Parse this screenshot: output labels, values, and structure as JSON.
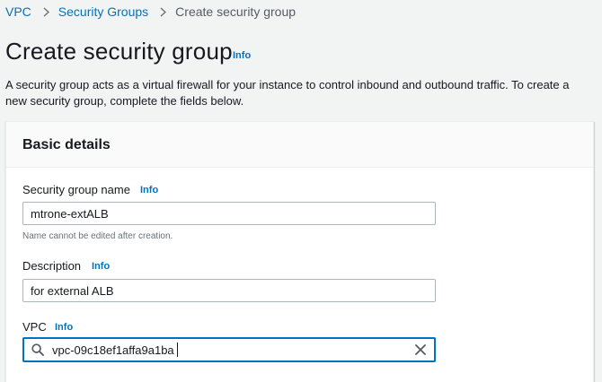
{
  "breadcrumb": {
    "items": [
      {
        "label": "VPC"
      },
      {
        "label": "Security Groups"
      }
    ],
    "current": "Create security group"
  },
  "page": {
    "title": "Create security group",
    "info_label": "Info",
    "description": "A security group acts as a virtual firewall for your instance to control inbound and outbound traffic. To create a new security group, complete the fields below."
  },
  "basic_details": {
    "title": "Basic details",
    "name_field": {
      "label": "Security group name",
      "info": "Info",
      "value": "mtrone-extALB",
      "constraint": "Name cannot be edited after creation."
    },
    "description_field": {
      "label": "Description",
      "info": "Info",
      "value": "for external ALB"
    },
    "vpc_field": {
      "label": "VPC",
      "info": "Info",
      "value": "vpc-09c18ef1affa9a1ba"
    }
  },
  "colors": {
    "link": "#0073bb",
    "focus_border": "#0073bb",
    "background": "#f2f3f3",
    "text": "#16191f"
  },
  "icons": {
    "breadcrumb_separator": "chevron-right-icon",
    "search": "search-icon",
    "clear": "close-icon"
  }
}
